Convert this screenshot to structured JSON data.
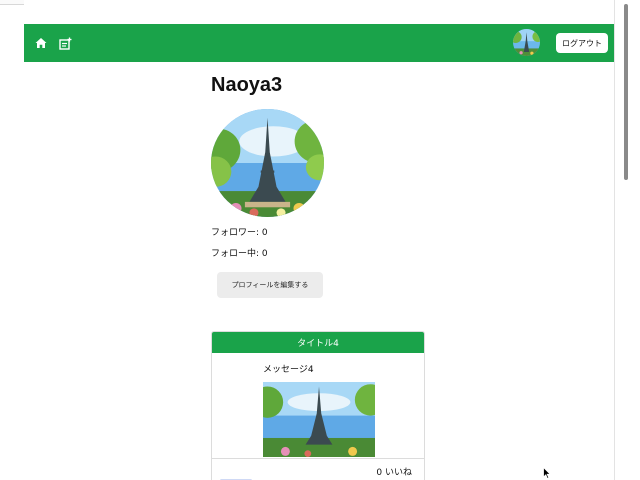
{
  "nav": {
    "home_icon": "home-icon",
    "new_post_icon": "new-post-icon",
    "logout_label": "ログアウト",
    "bar_color": "#1aa34a"
  },
  "profile": {
    "username": "Naoya3",
    "followers": "フォロワー: 0",
    "following": "フォロー中: 0",
    "edit_label": "プロフィールを編集する"
  },
  "post": {
    "title": "タイトル4",
    "message": "メッセージ4",
    "likes": "0 いいね"
  }
}
